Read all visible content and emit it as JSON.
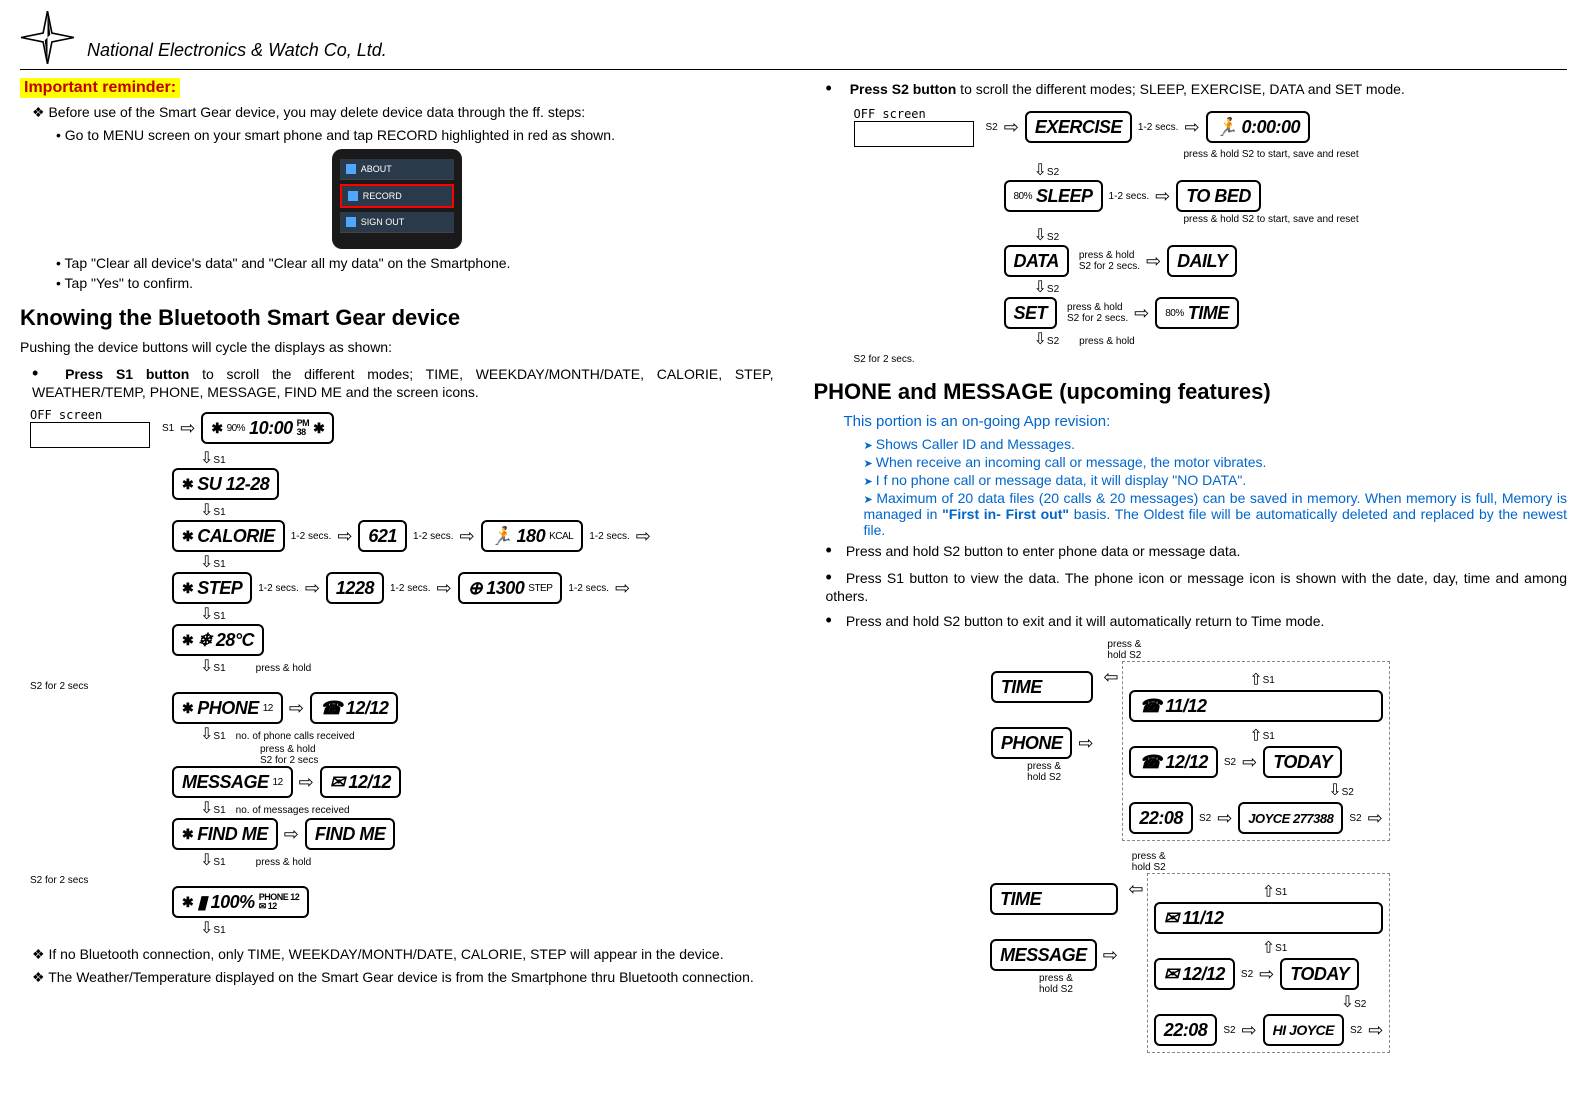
{
  "header": {
    "company": "National Electronics & Watch Co, Ltd."
  },
  "reminder": {
    "title": "Important reminder:",
    "intro": "Before use of the Smart Gear device, you may delete device data through the ff. steps:",
    "step1": "Go to MENU screen on your smart phone and tap RECORD highlighted in red as shown.",
    "step2": "Tap \"Clear all device's data\" and \"Clear all my data\" on the Smartphone.",
    "step3": "Tap \"Yes\" to confirm.",
    "phone": {
      "about": "ABOUT",
      "record": "RECORD",
      "signout": "SIGN OUT"
    }
  },
  "knowing": {
    "title": "Knowing the Bluetooth Smart Gear device",
    "intro": "Pushing the device buttons will cycle the displays as shown:",
    "s1_lead": "Press S1 button",
    "s1_rest": " to scroll the different modes; TIME, WEEKDAY/MONTH/DATE, CALORIE, STEP, WEATHER/TEMP, PHONE, MESSAGE, FIND ME and the screen icons.",
    "note1": "If no Bluetooth connection, only TIME, WEEKDAY/MONTH/DATE, CALORIE, STEP will appear in the device.",
    "note2": "The Weather/Temperature displayed on the Smart Gear device is from the Smartphone thru Bluetooth connection."
  },
  "s1diagram": {
    "off": "OFF screen",
    "s1arrow": "S1",
    "s1down": "S1",
    "time": {
      "pct": "90%",
      "time": "10:00",
      "pm": "PM",
      "min": "38"
    },
    "wkday": "SU  12-28",
    "calorie": {
      "label": "CALORIE",
      "v1": "621",
      "v2": "180",
      "unit": "KCAL"
    },
    "step": {
      "label": "STEP",
      "v1": "1228",
      "v2": "1300",
      "unit": "STEP"
    },
    "temp": "28°C",
    "phone": {
      "label": "PHONE",
      "cnt": "12",
      "date": "12/12",
      "note": "no. of phone calls received"
    },
    "message": {
      "label": "MESSAGE",
      "cnt": "12",
      "date": "12/12",
      "note": "no. of messages received"
    },
    "findme": "FIND ME",
    "battery": {
      "pct": "100%",
      "ph": "PHONE 12",
      "msg": "12"
    },
    "secs12": "1-2 secs.",
    "hold": "press & hold\nS2 for 2 secs"
  },
  "s2": {
    "lead": "Press S2 button",
    "rest": " to scroll the different modes; SLEEP, EXERCISE, DATA and SET mode."
  },
  "s2diagram": {
    "off": "OFF screen",
    "s2": "S2",
    "exercise": "EXERCISE",
    "exTime": "0:00:00",
    "exNote": "press & hold S2 to start, save and reset",
    "sleep": "SLEEP",
    "sleepPct": "80%",
    "tobed": "TO BED",
    "sleepNote": "press & hold S2 to start, save and reset",
    "data": "DATA",
    "daily": "DAILY",
    "set": "SET",
    "time": "TIME",
    "pct": "80%",
    "secs12": "1-2 secs.",
    "hold": "press & hold\nS2 for 2 secs."
  },
  "phonemsg": {
    "title": "PHONE and MESSAGE (upcoming features)",
    "sub": "This portion is an on-going App revision:",
    "a1": "Shows Caller ID and Messages.",
    "a2": "When receive an incoming call or message, the motor vibrates.",
    "a3": "I f no phone call or message data, it will display \"NO DATA\".",
    "a4a": "Maximum of 20 data files (20 calls & 20 messages) can be saved in memory. When memory is full, Memory is managed in ",
    "a4b": "\"First in- First out\"",
    "a4c": " basis. The Oldest file will be automatically deleted and replaced by the newest file.",
    "b1": "Press and hold S2 button to enter phone data or message data.",
    "b2": "Press S1 button to view the data. The phone icon or message icon is shown with the date, day, time and among others.",
    "b3": "Press and hold S2 button to exit and it will automatically return to Time mode."
  },
  "pmdiagram": {
    "time": "TIME",
    "phone": "PHONE",
    "message": "MESSAGE",
    "d1": "11/12",
    "d2": "12/12",
    "today": "TODAY",
    "t": "22:08",
    "caller": "JOYCE 277388",
    "msg": "HI JOYCE",
    "s1": "S1",
    "s2": "S2",
    "hold": "press &\nhold S2"
  }
}
